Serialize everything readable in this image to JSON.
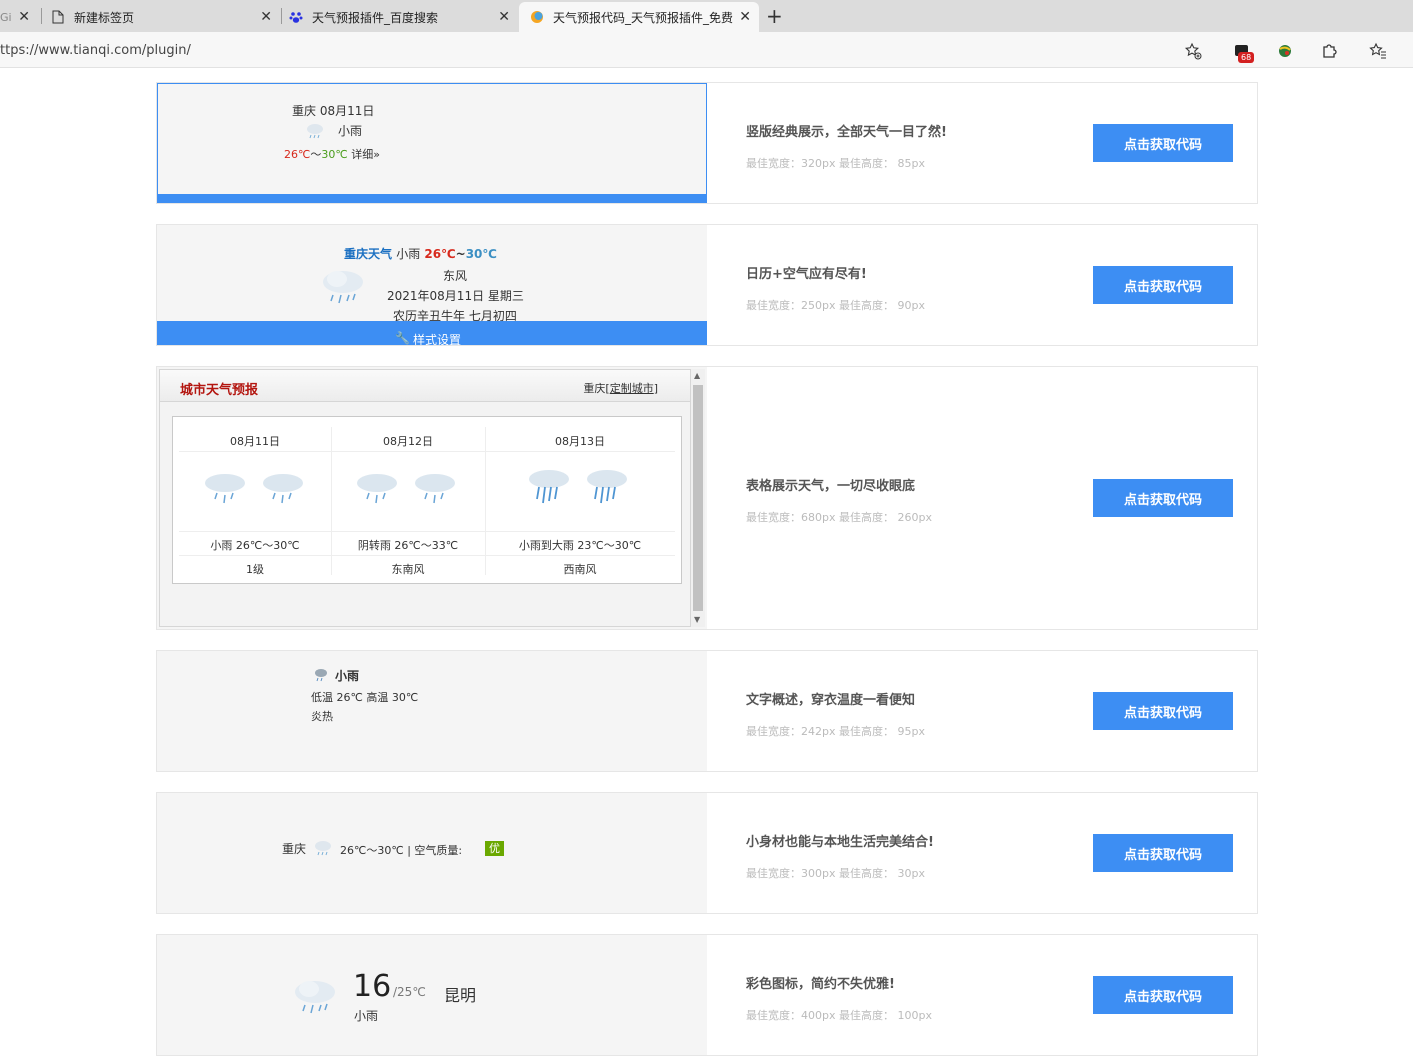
{
  "browser": {
    "tabs": [
      {
        "label": "Gi",
        "active": false
      },
      {
        "label": "新建标签页",
        "active": false
      },
      {
        "label": "天气预报插件_百度搜索",
        "active": false
      },
      {
        "label": "天气预报代码_天气预报插件_免费",
        "active": true
      }
    ],
    "address": "ttps://www.tianqi.com/plugin/",
    "badge_count": "68"
  },
  "common": {
    "button_label": "点击获取代码"
  },
  "widgets": [
    {
      "title": "竖版经典展示，全部天气一目了然!",
      "size": "最佳宽度：320px 最佳高度： 85px",
      "preview": {
        "line1": "重庆 08月11日",
        "weather": "小雨",
        "temp_low": "26℃",
        "temp_sep": "～",
        "temp_high": "30℃",
        "detail": "详细»"
      }
    },
    {
      "title": "日历+空气应有尽有!",
      "size": "最佳宽度：250px 最佳高度： 90px",
      "preview": {
        "city": "重庆天气",
        "weather": "小雨",
        "temp_low": "26℃",
        "temp_sep": "~",
        "temp_high": "30℃",
        "wind": "东风",
        "date": "2021年08月11日 星期三",
        "lunar": "农历辛丑牛年 七月初四",
        "settings": "样式设置"
      }
    },
    {
      "title": "表格展示天气，一切尽收眼底",
      "size": "最佳宽度：680px 最佳高度： 260px",
      "preview": {
        "header": "城市天气预报",
        "city": "重庆[",
        "custom": "定制城市",
        "city_close": "]",
        "days": [
          {
            "date": "08月11日",
            "desc": "小雨 26℃～30℃",
            "wind": "1级"
          },
          {
            "date": "08月12日",
            "desc": "阴转雨 26℃～33℃",
            "wind": "东南风"
          },
          {
            "date": "08月13日",
            "desc": "小雨到大雨 23℃～30℃",
            "wind": "西南风"
          }
        ]
      }
    },
    {
      "title": "文字概述，穿衣温度一看便知",
      "size": "最佳宽度：242px 最佳高度： 95px",
      "preview": {
        "weather": "小雨",
        "temps": "低温 26℃ 高温 30℃",
        "advice": "炎热"
      }
    },
    {
      "title": "小身材也能与本地生活完美结合!",
      "size": "最佳宽度：300px 最佳高度： 30px",
      "preview": {
        "city": "重庆",
        "temps": "26℃～30℃",
        "sep": "|",
        "aq_label": "空气质量:",
        "aq_value": "优"
      }
    },
    {
      "title": "彩色图标，简约不失优雅!",
      "size": "最佳宽度：400px 最佳高度： 100px",
      "preview": {
        "temp": "16",
        "temp_range": "/25℃",
        "city": "昆明",
        "weather": "小雨"
      }
    }
  ]
}
